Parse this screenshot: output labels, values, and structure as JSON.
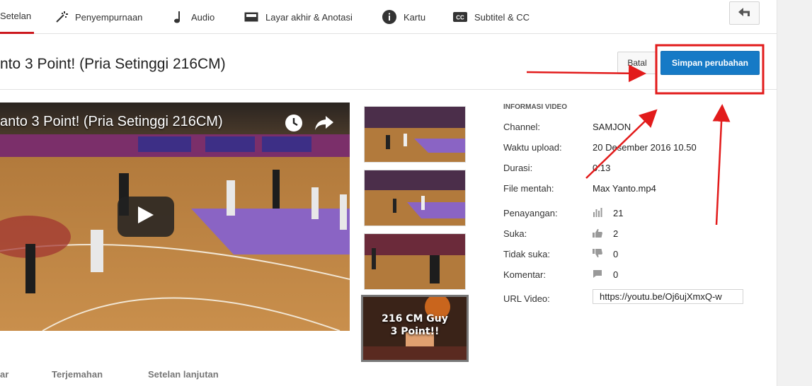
{
  "tabs": [
    {
      "label": "Setelan",
      "icon": "settings-icon",
      "active": true
    },
    {
      "label": "Penyempurnaan",
      "icon": "magic-wand-icon"
    },
    {
      "label": "Audio",
      "icon": "music-note-icon"
    },
    {
      "label": "Layar akhir & Anotasi",
      "icon": "end-screen-icon"
    },
    {
      "label": "Kartu",
      "icon": "info-icon"
    },
    {
      "label": "Subtitel & CC",
      "icon": "cc-icon"
    }
  ],
  "title_row": {
    "video_title": "nto 3 Point! (Pria Setinggi 216CM)",
    "cancel_label": "Batal",
    "save_label": "Simpan perubahan"
  },
  "player": {
    "title": "anto 3 Point! (Pria Setinggi 216CM)",
    "icons": [
      "clock-icon",
      "share-icon",
      "play-icon"
    ]
  },
  "thumbnails": [
    {
      "text": ""
    },
    {
      "text": ""
    },
    {
      "text": ""
    },
    {
      "text": "216 CM Guy\n3 Point!!",
      "selected": true
    }
  ],
  "info": {
    "heading": "INFORMASI VIDEO",
    "channel_label": "Channel:",
    "channel": "SAMJON",
    "upload_label": "Waktu upload:",
    "upload": "20 Desember 2016 10.50",
    "duration_label": "Durasi:",
    "duration": "0:13",
    "file_label": "File mentah:",
    "file": "Max Yanto.mp4",
    "views_label": "Penayangan:",
    "views": "21",
    "likes_label": "Suka:",
    "likes": "2",
    "dislikes_label": "Tidak suka:",
    "dislikes": "0",
    "comments_label": "Komentar:",
    "comments": "0",
    "url_label": "URL Video:",
    "url": "https://youtu.be/Oj6ujXmxQ-w"
  },
  "bottom_tabs": [
    "ar",
    "Terjemahan",
    "Setelan lanjutan"
  ],
  "colors": {
    "accent_red": "#cc181e",
    "save_blue": "#167ac6",
    "annotation_red": "#e21b1b"
  }
}
